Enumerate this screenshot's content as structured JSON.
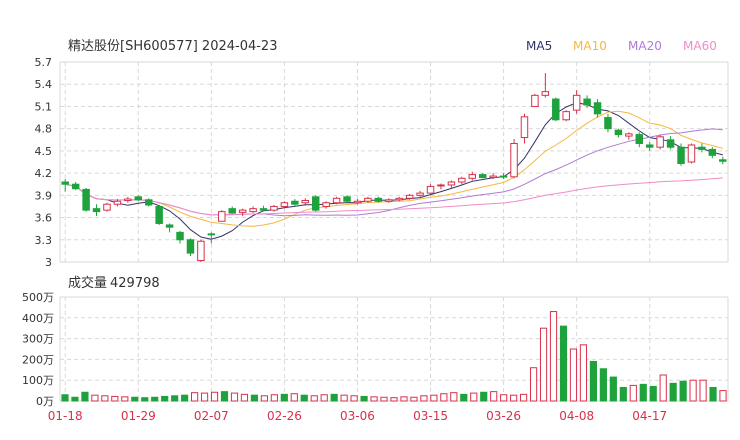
{
  "header": {
    "title": "精达股份[SH600577] 2024-04-23",
    "legend": [
      {
        "label": "MA5",
        "color": "#333366"
      },
      {
        "label": "MA10",
        "color": "#f4b942"
      },
      {
        "label": "MA20",
        "color": "#b07ad9"
      },
      {
        "label": "MA60",
        "color": "#f08cc8"
      }
    ]
  },
  "volume_header": {
    "label": "成交量",
    "value": "429798"
  },
  "colors": {
    "up": "#d9304a",
    "down": "#1ea33c",
    "grid": "#d9d9d9",
    "axis": "#333333",
    "date": "#d9304a"
  },
  "chart_data": [
    {
      "type": "candlestick",
      "ylim": [
        3.0,
        5.7
      ],
      "y_ticks": [
        "5.7",
        "5.4",
        "5.1",
        "4.8",
        "4.5",
        "4.2",
        "3.9",
        "3.6",
        "3.3",
        "3"
      ],
      "x_tick_labels": [
        {
          "label": "01-18",
          "index": 0
        },
        {
          "label": "01-29",
          "index": 7
        },
        {
          "label": "02-07",
          "index": 14
        },
        {
          "label": "02-26",
          "index": 21
        },
        {
          "label": "03-06",
          "index": 28
        },
        {
          "label": "03-15",
          "index": 35
        },
        {
          "label": "03-26",
          "index": 42
        },
        {
          "label": "04-08",
          "index": 49
        },
        {
          "label": "04-17",
          "index": 56
        }
      ],
      "ohlc": [
        [
          4.08,
          4.12,
          3.95,
          4.05
        ],
        [
          4.05,
          4.08,
          3.97,
          3.99
        ],
        [
          3.98,
          4.0,
          3.68,
          3.7
        ],
        [
          3.72,
          3.78,
          3.62,
          3.68
        ],
        [
          3.7,
          3.8,
          3.68,
          3.78
        ],
        [
          3.78,
          3.85,
          3.75,
          3.82
        ],
        [
          3.83,
          3.88,
          3.8,
          3.85
        ],
        [
          3.88,
          3.9,
          3.82,
          3.84
        ],
        [
          3.84,
          3.86,
          3.75,
          3.77
        ],
        [
          3.75,
          3.76,
          3.5,
          3.52
        ],
        [
          3.5,
          3.52,
          3.4,
          3.47
        ],
        [
          3.4,
          3.42,
          3.25,
          3.3
        ],
        [
          3.3,
          3.32,
          3.08,
          3.12
        ],
        [
          3.02,
          3.3,
          3.0,
          3.28
        ],
        [
          3.38,
          3.4,
          3.25,
          3.37
        ],
        [
          3.55,
          3.7,
          3.55,
          3.68
        ],
        [
          3.72,
          3.75,
          3.65,
          3.66
        ],
        [
          3.67,
          3.72,
          3.62,
          3.7
        ],
        [
          3.68,
          3.75,
          3.66,
          3.72
        ],
        [
          3.72,
          3.76,
          3.68,
          3.7
        ],
        [
          3.7,
          3.77,
          3.68,
          3.75
        ],
        [
          3.75,
          3.82,
          3.72,
          3.8
        ],
        [
          3.82,
          3.85,
          3.75,
          3.78
        ],
        [
          3.8,
          3.86,
          3.76,
          3.83
        ],
        [
          3.88,
          3.9,
          3.68,
          3.7
        ],
        [
          3.75,
          3.82,
          3.72,
          3.8
        ],
        [
          3.8,
          3.88,
          3.78,
          3.86
        ],
        [
          3.88,
          3.9,
          3.8,
          3.82
        ],
        [
          3.8,
          3.85,
          3.78,
          3.82
        ],
        [
          3.82,
          3.88,
          3.8,
          3.86
        ],
        [
          3.86,
          3.88,
          3.8,
          3.82
        ],
        [
          3.82,
          3.86,
          3.8,
          3.84
        ],
        [
          3.84,
          3.88,
          3.82,
          3.86
        ],
        [
          3.86,
          3.92,
          3.84,
          3.9
        ],
        [
          3.9,
          3.96,
          3.88,
          3.93
        ],
        [
          3.93,
          4.05,
          3.92,
          4.02
        ],
        [
          4.03,
          4.06,
          3.98,
          4.04
        ],
        [
          4.04,
          4.1,
          4.0,
          4.08
        ],
        [
          4.08,
          4.15,
          4.05,
          4.13
        ],
        [
          4.13,
          4.22,
          4.1,
          4.18
        ],
        [
          4.18,
          4.2,
          4.13,
          4.14
        ],
        [
          4.14,
          4.2,
          4.12,
          4.16
        ],
        [
          4.16,
          4.2,
          4.12,
          4.15
        ],
        [
          4.15,
          4.66,
          4.13,
          4.6
        ],
        [
          4.68,
          5.0,
          4.6,
          4.96
        ],
        [
          5.1,
          5.27,
          5.1,
          5.25
        ],
        [
          5.25,
          5.55,
          5.22,
          5.3
        ],
        [
          5.2,
          5.22,
          4.9,
          4.92
        ],
        [
          4.92,
          5.05,
          4.9,
          5.03
        ],
        [
          5.05,
          5.32,
          5.0,
          5.25
        ],
        [
          5.2,
          5.25,
          5.08,
          5.12
        ],
        [
          5.15,
          5.2,
          4.95,
          5.0
        ],
        [
          4.95,
          5.0,
          4.75,
          4.8
        ],
        [
          4.78,
          4.8,
          4.68,
          4.72
        ],
        [
          4.7,
          4.75,
          4.65,
          4.73
        ],
        [
          4.72,
          4.75,
          4.55,
          4.6
        ],
        [
          4.58,
          4.62,
          4.5,
          4.55
        ],
        [
          4.55,
          4.72,
          4.52,
          4.69
        ],
        [
          4.65,
          4.7,
          4.52,
          4.55
        ],
        [
          4.55,
          4.6,
          4.3,
          4.33
        ],
        [
          4.35,
          4.6,
          4.33,
          4.58
        ],
        [
          4.55,
          4.6,
          4.48,
          4.52
        ],
        [
          4.52,
          4.55,
          4.4,
          4.44
        ],
        [
          4.38,
          4.42,
          4.32,
          4.36
        ]
      ]
    },
    {
      "type": "bar",
      "ylabel": "成交量",
      "ylim": [
        0,
        500
      ],
      "y_ticks": [
        "500万",
        "400万",
        "300万",
        "200万",
        "100万",
        "0万"
      ],
      "values": [
        30,
        18,
        42,
        28,
        25,
        22,
        20,
        18,
        16,
        18,
        22,
        25,
        28,
        40,
        38,
        42,
        45,
        38,
        32,
        28,
        25,
        30,
        32,
        35,
        28,
        25,
        30,
        32,
        28,
        25,
        22,
        20,
        18,
        16,
        20,
        18,
        25,
        28,
        35,
        40,
        32,
        38,
        42,
        45,
        30,
        28,
        32,
        160,
        350,
        430,
        360,
        250,
        270,
        190,
        155,
        115,
        65,
        75,
        80,
        70,
        125,
        85,
        95,
        100,
        100,
        65,
        50
      ],
      "directions": [
        "d",
        "d",
        "d",
        "u",
        "u",
        "u",
        "u",
        "d",
        "d",
        "d",
        "d",
        "d",
        "d",
        "u",
        "u",
        "u",
        "d",
        "u",
        "u",
        "d",
        "u",
        "u",
        "d",
        "u",
        "d",
        "u",
        "u",
        "d",
        "u",
        "u",
        "d",
        "u",
        "u",
        "u",
        "u",
        "u",
        "u",
        "u",
        "u",
        "u",
        "d",
        "u",
        "d",
        "u",
        "u",
        "u",
        "u",
        "u",
        "u",
        "u",
        "d",
        "u",
        "u",
        "d",
        "d",
        "d",
        "d",
        "u",
        "d",
        "d",
        "u",
        "d",
        "d",
        "u",
        "u",
        "d",
        "u"
      ]
    }
  ]
}
